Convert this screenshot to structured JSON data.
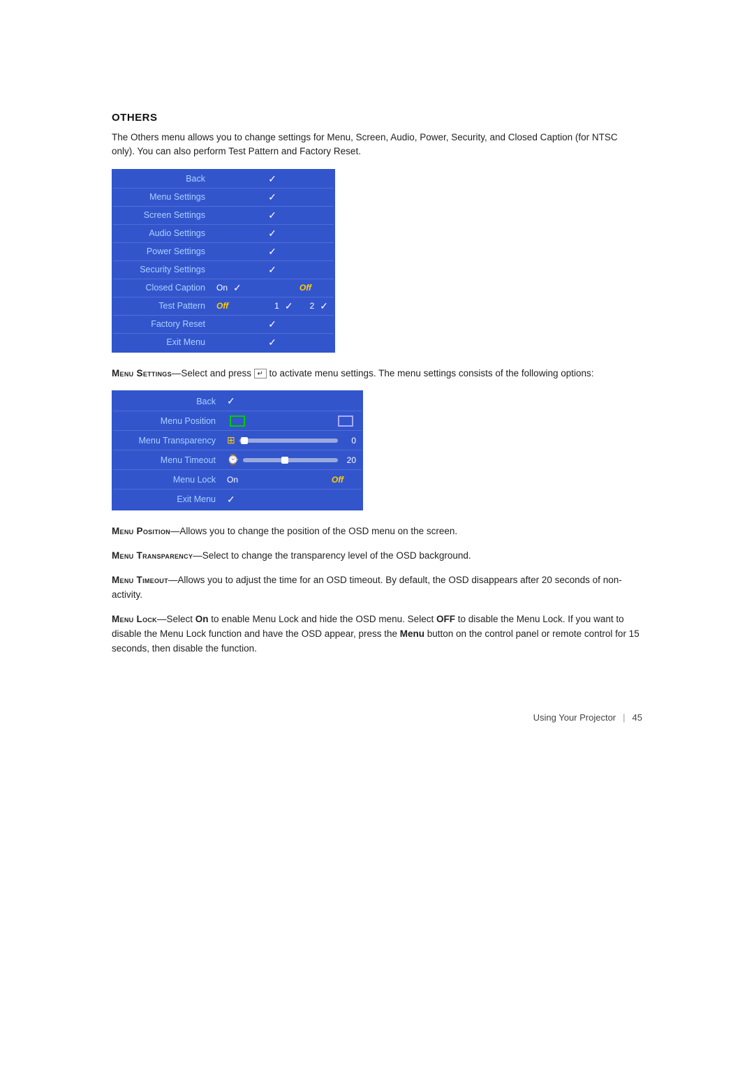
{
  "section": {
    "title": "OTHERS",
    "intro": "The Others menu allows you to change settings for Menu, Screen, Audio, Power, Security, and Closed Caption (for NTSC only). You can also perform Test Pattern and Factory Reset."
  },
  "othersTable": {
    "rows": [
      {
        "label": "Back",
        "value": "✓",
        "type": "check"
      },
      {
        "label": "Menu Settings",
        "value": "✓",
        "type": "check"
      },
      {
        "label": "Screen Settings",
        "value": "✓",
        "type": "check"
      },
      {
        "label": "Audio Settings",
        "value": "✓",
        "type": "check"
      },
      {
        "label": "Power Settings",
        "value": "✓",
        "type": "check"
      },
      {
        "label": "Security Settings",
        "value": "✓",
        "type": "check"
      },
      {
        "label": "Closed Caption",
        "value": "On ✓   Off",
        "type": "on-off"
      },
      {
        "label": "Test Pattern",
        "value": "Off   1 ✓   2 ✓",
        "type": "pattern"
      },
      {
        "label": "Factory Reset",
        "value": "✓",
        "type": "check"
      },
      {
        "label": "Exit Menu",
        "value": "✓",
        "type": "check"
      }
    ]
  },
  "menuSettingsIntro": "—Select and press  to activate menu settings. The menu settings consists of the following options:",
  "menuSettingsTitle": "Menu Settings",
  "menuSettingsTable": {
    "rows": [
      {
        "label": "Back",
        "value": "✓",
        "type": "check"
      },
      {
        "label": "Menu Position",
        "value": "",
        "type": "position"
      },
      {
        "label": "Menu Transparency",
        "value": "0",
        "type": "slider"
      },
      {
        "label": "Menu Timeout",
        "value": "20",
        "type": "slider"
      },
      {
        "label": "Menu Lock",
        "value": "On   Off",
        "type": "on-off"
      },
      {
        "label": "Exit Menu",
        "value": "✓",
        "type": "check"
      }
    ]
  },
  "descriptions": [
    {
      "id": "menu-position",
      "title": "Menu Position",
      "titlePrefix": "Menu",
      "titleSuffix": "Position",
      "text": "—Allows you to change the position of the OSD menu on the screen."
    },
    {
      "id": "menu-transparency",
      "title": "Menu Transparency",
      "titlePrefix": "Menu",
      "titleSuffix": "Transparency",
      "text": "—Select to change the transparency level of the OSD background."
    },
    {
      "id": "menu-timeout",
      "title": "Menu Timeout",
      "titlePrefix": "Menu",
      "titleSuffix": "Timeout",
      "text": "—Allows you to adjust the time for an OSD timeout. By default, the OSD disappears after 20 seconds of non-activity."
    },
    {
      "id": "menu-lock",
      "title": "Menu Lock",
      "titlePrefix": "Menu",
      "titleSuffix": "Lock",
      "text": "—Select On to enable Menu Lock and hide the OSD menu. Select OFF to disable the Menu Lock. If you want to disable the Menu Lock function and have the OSD appear, press the Menu button on the control panel or remote control for 15 seconds, then disable the function."
    }
  ],
  "footer": {
    "label": "Using Your Projector",
    "divider": "|",
    "pageNum": "45"
  }
}
